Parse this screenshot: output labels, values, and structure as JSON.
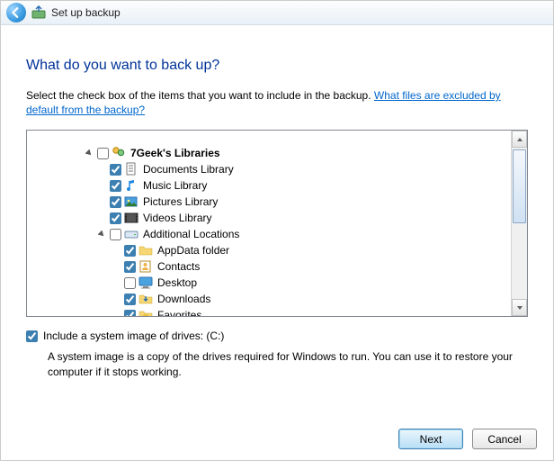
{
  "window": {
    "title": "Set up backup"
  },
  "heading": "What do you want to back up?",
  "intro_text": "Select the check box of the items that you want to include in the backup. ",
  "intro_link": "What files are excluded by default from the backup?",
  "tree": {
    "root": {
      "label": "7Geek's Libraries",
      "children": [
        {
          "label": "Documents Library"
        },
        {
          "label": "Music Library"
        },
        {
          "label": "Pictures Library"
        },
        {
          "label": "Videos Library"
        }
      ],
      "additional": {
        "label": "Additional Locations",
        "children": [
          {
            "label": "AppData folder"
          },
          {
            "label": "Contacts"
          },
          {
            "label": "Desktop"
          },
          {
            "label": "Downloads"
          },
          {
            "label": "Favorites"
          }
        ]
      }
    }
  },
  "system_image": {
    "label": "Include a system image of drives: (C:)",
    "description": "A system image is a copy of the drives required for Windows to run. You can use it to restore your computer if it stops working."
  },
  "buttons": {
    "next": "Next",
    "cancel": "Cancel"
  }
}
